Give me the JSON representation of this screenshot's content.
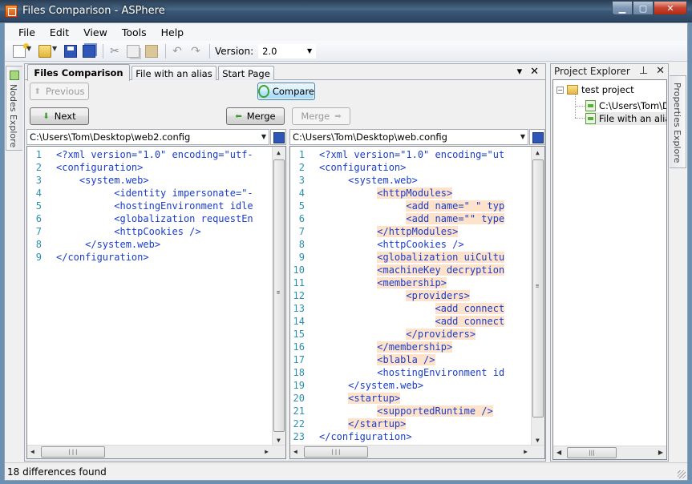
{
  "window": {
    "title": "Files Comparison - ASPhere",
    "controls": {
      "minimize": "▁",
      "maximize": "▢",
      "close": "✕"
    }
  },
  "menu": [
    "File",
    "Edit",
    "View",
    "Tools",
    "Help"
  ],
  "toolbar": {
    "version_label": "Version:",
    "version_value": "2.0",
    "icons": [
      "new-file-icon",
      "open-folder-icon",
      "save-icon",
      "save-all-icon",
      "cut-icon",
      "copy-icon",
      "paste-icon",
      "undo-icon",
      "redo-icon"
    ]
  },
  "side_tabs": {
    "left": "Nodes Explore",
    "right": "Properties Explore"
  },
  "document": {
    "tabs": [
      {
        "label": "Files Comparison",
        "active": true
      },
      {
        "label": "File with an alias",
        "active": false
      },
      {
        "label": "Start Page",
        "active": false
      }
    ],
    "tab_tools": {
      "pin": "▾",
      "close": "✕"
    },
    "buttons": {
      "previous": "Previous",
      "compare": "Compare",
      "next": "Next",
      "merge_left": "Merge",
      "merge_right": "Merge"
    },
    "left": {
      "path": "C:\\Users\\Tom\\Desktop\\web2.config",
      "lines": [
        {
          "n": "1",
          "code": "<?xml version=\"1.0\" encoding=\"utf-"
        },
        {
          "n": "2",
          "code": "<configuration>"
        },
        {
          "n": "3",
          "code": "    <system.web>"
        },
        {
          "n": "4",
          "code": "          <identity impersonate=\"-"
        },
        {
          "n": "5",
          "code": "          <hostingEnvironment idle"
        },
        {
          "n": "6",
          "code": "          <globalization requestEn"
        },
        {
          "n": "7",
          "code": "          <httpCookies />"
        },
        {
          "n": "8",
          "code": "     </system.web>"
        },
        {
          "n": "9",
          "code": "</configuration>"
        }
      ]
    },
    "right": {
      "path": "C:\\Users\\Tom\\Desktop\\web.config",
      "lines": [
        {
          "n": "1",
          "code": "<?xml version=\"1.0\" encoding=\"ut",
          "hl": false
        },
        {
          "n": "2",
          "code": "<configuration>",
          "hl": false
        },
        {
          "n": "3",
          "code": "     <system.web>",
          "hl": false
        },
        {
          "n": "4",
          "code": "          <httpModules>",
          "hl": true
        },
        {
          "n": "5",
          "code": "               <add name=\" \" typ",
          "hl": true
        },
        {
          "n": "6",
          "code": "               <add name=\"\" type",
          "hl": true
        },
        {
          "n": "7",
          "code": "          </httpModules>",
          "hl": true
        },
        {
          "n": "8",
          "code": "          <httpCookies />",
          "hl": false
        },
        {
          "n": "9",
          "code": "          <globalization uiCultu",
          "hl": true
        },
        {
          "n": "10",
          "code": "          <machineKey decryption",
          "hl": true
        },
        {
          "n": "11",
          "code": "          <membership>",
          "hl": true
        },
        {
          "n": "12",
          "code": "               <providers>",
          "hl": true
        },
        {
          "n": "13",
          "code": "                    <add connect",
          "hl": true
        },
        {
          "n": "14",
          "code": "                    <add connect",
          "hl": true
        },
        {
          "n": "15",
          "code": "               </providers>",
          "hl": true
        },
        {
          "n": "16",
          "code": "          </membership>",
          "hl": true
        },
        {
          "n": "17",
          "code": "          <blabla />",
          "hl": true
        },
        {
          "n": "18",
          "code": "          <hostingEnvironment id",
          "hl": false
        },
        {
          "n": "19",
          "code": "     </system.web>",
          "hl": false
        },
        {
          "n": "20",
          "code": "     <startup>",
          "hl": true
        },
        {
          "n": "21",
          "code": "          <supportedRuntime />",
          "hl": true
        },
        {
          "n": "22",
          "code": "     </startup>",
          "hl": true
        },
        {
          "n": "23",
          "code": "</configuration>",
          "hl": false
        }
      ]
    }
  },
  "project_explorer": {
    "title": "Project Explorer",
    "tools": {
      "pin": "⊥",
      "close": "✕"
    },
    "root": "test project",
    "items": [
      "C:\\Users\\Tom\\D",
      "File with an alias"
    ]
  },
  "status": "18 differences found",
  "colors": {
    "diff_highlight": "#fde2cc",
    "line_number": "#2b91af",
    "tag": "#1a3cc9",
    "attr": "#c00000"
  }
}
